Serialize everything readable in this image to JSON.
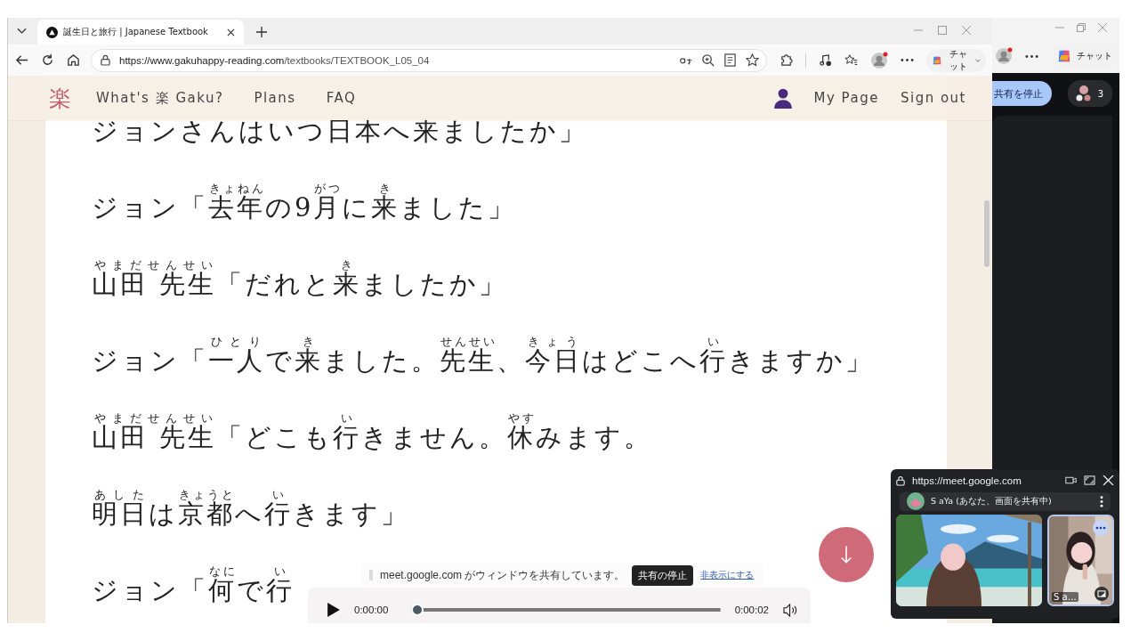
{
  "browser": {
    "tab": {
      "title": "誕生日と旅行 | Japanese Textbook",
      "selected": true
    },
    "url": {
      "origin": "https://www.gakuhappy-reading.com",
      "path": "/textbooks/TEXTBOOK_L05_04"
    },
    "chat_button": "チャット"
  },
  "site_nav": {
    "logo": "楽",
    "links": [
      "What's 楽 Gaku?",
      "Plans",
      "FAQ"
    ],
    "account_links": [
      "My Page",
      "Sign out"
    ]
  },
  "lines": [
    {
      "segments": [
        {
          "text": "ジョンさんはいつ日本へ来ましたか」"
        }
      ]
    },
    {
      "segments": [
        {
          "text": "ジョン「"
        },
        {
          "text": "去年",
          "ruby": "きょねん"
        },
        {
          "text": "の9"
        },
        {
          "text": "月",
          "ruby": "がつ"
        },
        {
          "text": "に"
        },
        {
          "text": "来",
          "ruby": "き"
        },
        {
          "text": "ました」"
        }
      ]
    },
    {
      "segments": [
        {
          "text": "山田 先生",
          "ruby": "やまだせんせい"
        },
        {
          "text": "「だれと"
        },
        {
          "text": "来",
          "ruby": "き"
        },
        {
          "text": "ましたか」"
        }
      ]
    },
    {
      "segments": [
        {
          "text": "ジョン「"
        },
        {
          "text": "一人",
          "ruby": "ひとり"
        },
        {
          "text": "で"
        },
        {
          "text": "来",
          "ruby": "き"
        },
        {
          "text": "ました。"
        },
        {
          "text": "先生",
          "ruby": "せんせい"
        },
        {
          "text": "、"
        },
        {
          "text": "今日",
          "ruby": "きょう"
        },
        {
          "text": "はどこへ"
        },
        {
          "text": "行",
          "ruby": "い"
        },
        {
          "text": "きますか」"
        }
      ]
    },
    {
      "segments": [
        {
          "text": "山田 先生",
          "ruby": "やまだせんせい"
        },
        {
          "text": "「どこも"
        },
        {
          "text": "行",
          "ruby": "い"
        },
        {
          "text": "きません。"
        },
        {
          "text": "休",
          "ruby": "やす"
        },
        {
          "text": "みます。"
        }
      ]
    },
    {
      "segments": [
        {
          "text": "明日",
          "ruby": "あした"
        },
        {
          "text": "は"
        },
        {
          "text": "京都",
          "ruby": "きょうと"
        },
        {
          "text": "へ"
        },
        {
          "text": "行",
          "ruby": "い"
        },
        {
          "text": "きます」"
        }
      ]
    },
    {
      "segments": [
        {
          "text": "ジョン「"
        },
        {
          "text": "何",
          "ruby": "なに"
        },
        {
          "text": "で"
        },
        {
          "text": "行",
          "ruby": "い"
        }
      ]
    }
  ],
  "share_bar": {
    "message": "meet.google.com がウィンドウを共有しています。",
    "stop_button": "共有の停止",
    "hide_link": "非表示にする"
  },
  "audio_player": {
    "current": "0:00:00",
    "duration": "0:00:02",
    "level": 0
  },
  "meet_window": {
    "chat_button": "チャット",
    "stop_sharing_button": "共有を停止",
    "participant_count": "3"
  },
  "meet_popup": {
    "url": "https://meet.google.com",
    "presenter": "S aYa (あなた、画面を共有中)",
    "tiles": [
      {
        "kind": "picture"
      },
      {
        "kind": "picture",
        "name": "S a…"
      }
    ]
  }
}
